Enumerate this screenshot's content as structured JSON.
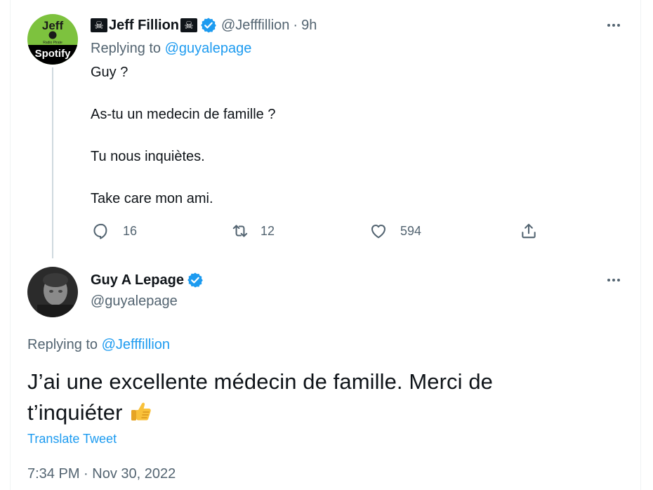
{
  "tweet1": {
    "avatar": {
      "line1": "Jeff",
      "line2": "Radio  Pirate",
      "line3": "Spotify"
    },
    "name": "Jeff Fillion",
    "name_emoji": "☠",
    "handle": "@Jefffillion",
    "separator": "·",
    "time": "9h",
    "replying_prefix": "Replying to ",
    "replying_to": "@guyalepage",
    "body": [
      "Guy ?",
      "As-tu un medecin de famille ?",
      "Tu nous inquiètes.",
      "Take care mon ami."
    ],
    "actions": {
      "replies": "16",
      "retweets": "12",
      "likes": "594"
    }
  },
  "tweet2": {
    "name": "Guy A Lepage",
    "handle": "@guyalepage",
    "replying_prefix": "Replying to ",
    "replying_to": "@Jefffillion",
    "body_line1": "J’ai une excellente médecin de famille. Merci de",
    "body_line2": "t’inquiéter",
    "translate": "Translate Tweet",
    "timestamp": "7:34 PM · Nov 30, 2022"
  },
  "colors": {
    "accent": "#1d9bf0",
    "text": "#0f1419",
    "muted": "#536471",
    "verified": "#1d9bf0"
  }
}
